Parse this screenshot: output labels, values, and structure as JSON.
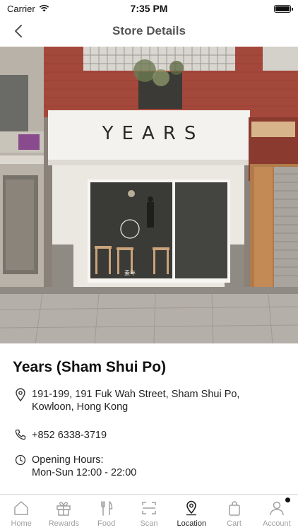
{
  "status_bar": {
    "carrier": "Carrier",
    "time": "7:35 PM"
  },
  "nav": {
    "title": "Store Details"
  },
  "hero": {
    "sign_text": "YEARS",
    "window_logo_text": "素年"
  },
  "store": {
    "name": "Years (Sham Shui Po)",
    "address": "191-199, 191 Fuk Wah Street, Sham Shui Po, Kowloon, Hong Kong",
    "phone": "+852 6338-3719",
    "hours_label": "Opening Hours:",
    "hours_value": "Mon-Sun 12:00 - 22:00"
  },
  "tabs": [
    {
      "label": "Home",
      "icon": "home-icon"
    },
    {
      "label": "Rewards",
      "icon": "gift-icon"
    },
    {
      "label": "Food",
      "icon": "fork-knife-icon"
    },
    {
      "label": "Scan",
      "icon": "scan-icon"
    },
    {
      "label": "Location",
      "icon": "location-pin-icon",
      "active": true
    },
    {
      "label": "Cart",
      "icon": "shopping-bag-icon"
    },
    {
      "label": "Account",
      "icon": "account-icon",
      "badge": true
    }
  ],
  "colors": {
    "active_tab": "#222222",
    "inactive_tab": "#a0a0a0",
    "storefront_sign": "#f4f2ee",
    "brick": "#a5483c"
  }
}
